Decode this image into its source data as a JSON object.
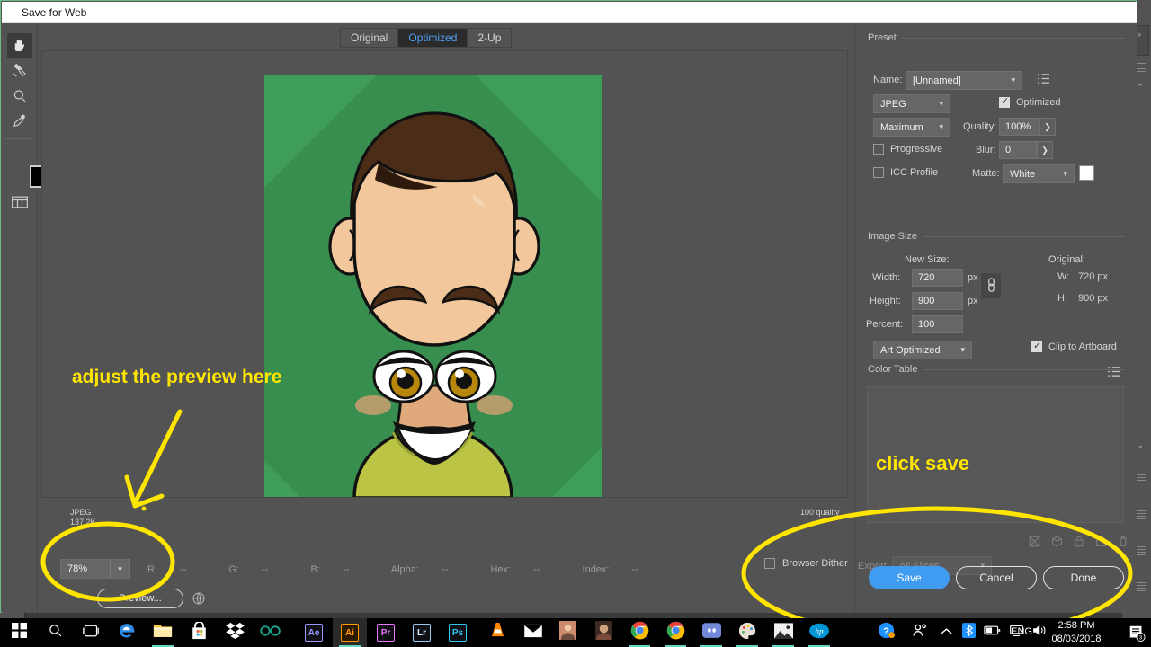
{
  "window": {
    "title": "Save for Web"
  },
  "tools": [
    {
      "name": "hand-tool",
      "icon": "hand-icon",
      "active": true
    },
    {
      "name": "slice-select-tool",
      "icon": "slice-select-icon",
      "active": false
    },
    {
      "name": "zoom-tool",
      "icon": "magnifier-icon",
      "active": false
    },
    {
      "name": "eyedropper-tool",
      "icon": "eyedropper-icon",
      "active": false
    },
    {
      "name": "foreground-color-swatch",
      "icon": "color-swatch-icon",
      "active": false
    },
    {
      "name": "toggle-slices-visibility",
      "icon": "slices-visibility-icon",
      "active": false
    }
  ],
  "tabs": [
    {
      "label": "Original",
      "active": false
    },
    {
      "label": "Optimized",
      "active": true
    },
    {
      "label": "2-Up",
      "active": false
    }
  ],
  "canvas": {
    "format_line1": "JPEG",
    "format_line2": "137.2K",
    "quality_note": "100 quality",
    "artwork_bg_color": "#3e9e57",
    "artwork_shadow_color": "#378e4e",
    "shirt_color": "#bcc445",
    "skin_color": "#f2c79b",
    "hair_color": "#4a2c17"
  },
  "bottom_bar": {
    "zoom_value": "78%",
    "zoom_dropdown_icon": "chevron-down-icon",
    "readouts": [
      {
        "label": "R:",
        "value": "--"
      },
      {
        "label": "G:",
        "value": "--"
      },
      {
        "label": "B:",
        "value": "--"
      },
      {
        "label": "Alpha:",
        "value": "--"
      },
      {
        "label": "Hex:",
        "value": "--"
      },
      {
        "label": "Index:",
        "value": "--"
      }
    ],
    "preview_button": "Preview...",
    "browser_icon": "globe-icon"
  },
  "preset": {
    "section_title": "Preset",
    "name_label": "Name:",
    "name_value": "[Unnamed]",
    "menu_icon": "preset-menu-icon",
    "format_value": "JPEG",
    "optimized_label": "Optimized",
    "optimized_checked": true,
    "quality_preset_value": "Maximum",
    "quality_label": "Quality:",
    "quality_value": "100%",
    "quality_stepper_icon": "chevron-right-icon",
    "progressive_label": "Progressive",
    "progressive_checked": false,
    "blur_label": "Blur:",
    "blur_value": "0",
    "blur_stepper_icon": "chevron-right-icon",
    "icc_label": "ICC Profile",
    "icc_checked": false,
    "matte_label": "Matte:",
    "matte_value": "White",
    "matte_color": "#ffffff"
  },
  "image_size": {
    "section_title": "Image Size",
    "new_size_label": "New Size:",
    "original_label": "Original:",
    "width_label": "Width:",
    "width_value": "720",
    "width_unit": "px",
    "height_label": "Height:",
    "height_value": "900",
    "height_unit": "px",
    "percent_label": "Percent:",
    "percent_value": "100",
    "constrain_icon": "link-chain-icon",
    "orig_w_label": "W:",
    "orig_w_value": "720 px",
    "orig_h_label": "H:",
    "orig_h_value": "900 px",
    "resample_value": "Art Optimized",
    "clip_label": "Clip to Artboard",
    "clip_checked": true
  },
  "color_table": {
    "section_title": "Color Table",
    "menu_icon": "color-table-menu-icon",
    "tool_icons": [
      "web-shift-icon",
      "transparency-icon",
      "lock-icon",
      "new-color-icon",
      "trash-icon"
    ]
  },
  "export": {
    "browser_dither_label": "Browser Dither",
    "browser_dither_checked": false,
    "export_label": "Export:",
    "export_value": "All Slices",
    "export_chevron_icon": "chevron-down-icon",
    "save_label": "Save",
    "cancel_label": "Cancel",
    "done_label": "Done",
    "save_color": "#3f9cf0"
  },
  "annotations": {
    "color": "#ffe500",
    "preview_note": "adjust the preview here",
    "save_note": "click save"
  },
  "taskbar": {
    "start_icon": "windows-start-icon",
    "search_icon": "search-icon",
    "taskview_icon": "task-view-icon",
    "items": [
      {
        "name": "edge-icon",
        "label": "e",
        "color": "#2d8ae5",
        "type": "edge",
        "running": false
      },
      {
        "name": "file-explorer-icon",
        "label": "",
        "color": "#ffc83d",
        "type": "folder",
        "running": true
      },
      {
        "name": "microsoft-store-icon",
        "label": "",
        "color": "#ffffff",
        "type": "store",
        "running": false
      },
      {
        "name": "dropbox-icon",
        "label": "",
        "color": "#ffffff",
        "type": "dropbox",
        "running": false
      },
      {
        "name": "onedrive-link-icon",
        "label": "",
        "color": "#1aa38a",
        "type": "loop",
        "running": false
      },
      {
        "name": "after-effects-icon",
        "label": "Ae",
        "color": "#9999ff",
        "type": "adobe",
        "running": false
      },
      {
        "name": "illustrator-icon",
        "label": "Ai",
        "color": "#ff9a00",
        "type": "adobe",
        "running": true,
        "focused": true
      },
      {
        "name": "premiere-icon",
        "label": "Pr",
        "color": "#ea77ff",
        "type": "adobe",
        "running": false
      },
      {
        "name": "lightroom-icon",
        "label": "Lr",
        "color": "#d6eaff",
        "type": "adobe",
        "running": false
      },
      {
        "name": "photoshop-icon",
        "label": "Ps",
        "color": "#31c5f0",
        "type": "adobe",
        "running": false
      },
      {
        "name": "vlc-icon",
        "label": "",
        "color": "#ff8800",
        "type": "cone",
        "running": false
      },
      {
        "name": "mail-icon",
        "label": "",
        "color": "#ffffff",
        "type": "envelope",
        "running": false
      },
      {
        "name": "photos-app-icon",
        "label": "",
        "color": "#c98b6b",
        "type": "photo",
        "running": false
      },
      {
        "name": "user-photo-icon",
        "label": "",
        "color": "#d2a17f",
        "type": "photo2",
        "running": false
      },
      {
        "name": "chrome-icon",
        "label": "",
        "color": "#4285f4",
        "type": "chrome",
        "running": true
      },
      {
        "name": "chrome-icon-2",
        "label": "",
        "color": "#4285f4",
        "type": "chrome",
        "running": true
      },
      {
        "name": "discord-icon",
        "label": "",
        "color": "#7289da",
        "type": "discord",
        "running": true
      },
      {
        "name": "paint-icon",
        "label": "",
        "color": "#dddddd",
        "type": "paint",
        "running": true
      },
      {
        "name": "photo-viewer-icon",
        "label": "",
        "color": "#f0f0f0",
        "type": "mountain",
        "running": true
      },
      {
        "name": "hp-icon",
        "label": "hp",
        "color": "#0096d6",
        "type": "hp",
        "running": true
      }
    ],
    "tray": {
      "help_icon": "help-circle-icon",
      "people_icon": "people-icon",
      "chevron_icon": "chevron-up-icon",
      "bluetooth_icon": "bluetooth-icon",
      "battery_icon": "battery-icon",
      "network_icon": "network-icon",
      "volume_icon": "volume-icon"
    },
    "language": "ENG",
    "time": "2:58 PM",
    "date": "08/03/2018",
    "notification_icon": "notifications-icon",
    "notification_count": "3"
  }
}
